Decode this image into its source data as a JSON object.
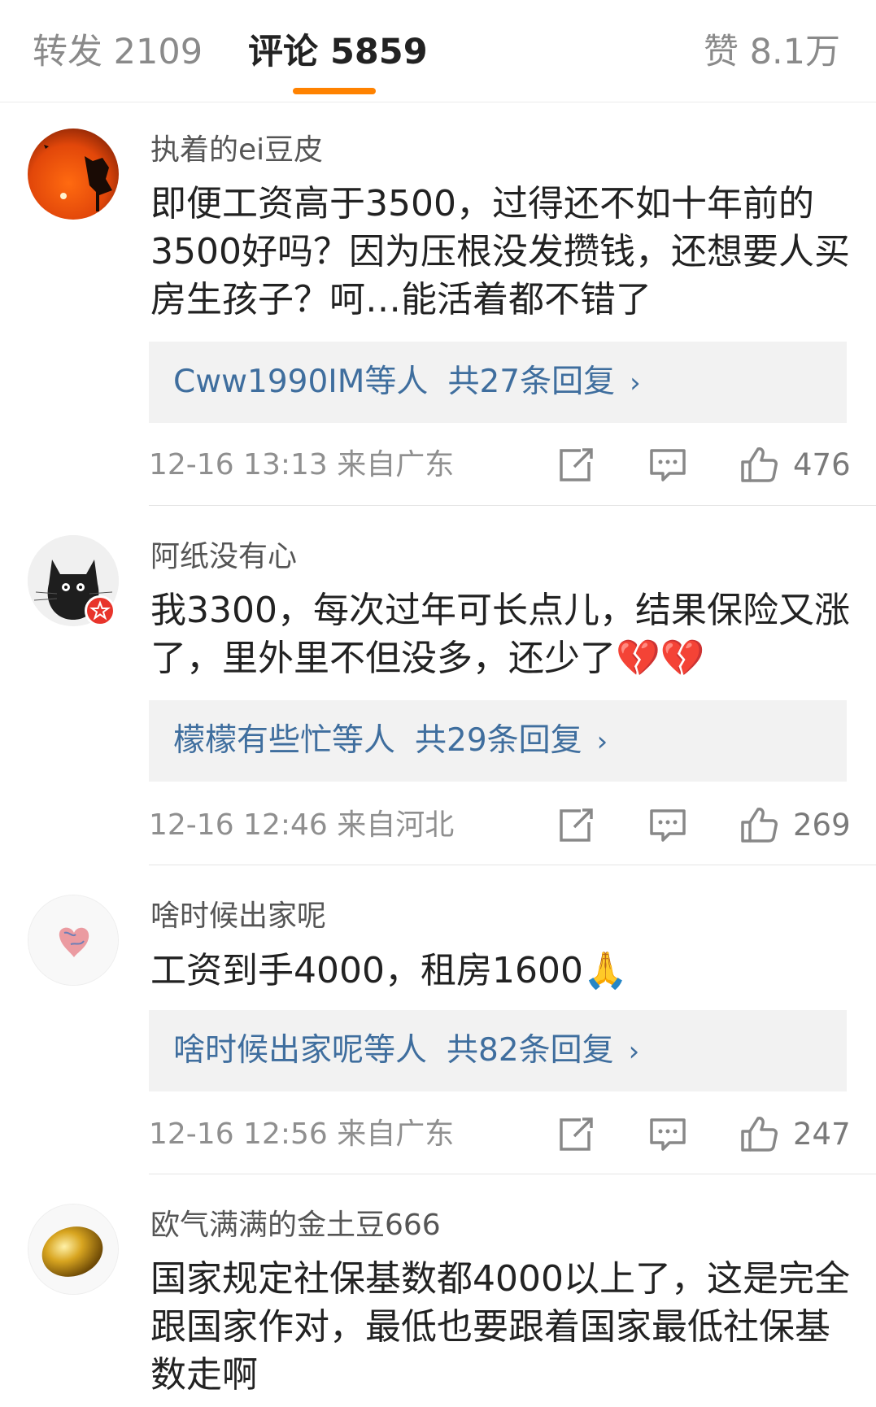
{
  "tabs": {
    "repost": "转发 2109",
    "comments": "评论 5859",
    "likes": "赞 8.1万"
  },
  "colors": {
    "accent": "#ff8200",
    "link": "#3f6e9e",
    "reply_bg": "#f2f2f2"
  },
  "comments": [
    {
      "username": "执着的ei豆皮",
      "text": "即便工资高于3500，过得还不如十年前的3500好吗？因为压根没发攒钱，还想要人买房生孩子？呵…能活着都不错了",
      "reply_users": "Cww1990IM等人",
      "reply_count": "共27条回复",
      "meta": "12-16 13:13  来自广东",
      "likes": "476",
      "avatar_icon": "sunset-avatar"
    },
    {
      "username": "阿纸没有心",
      "text": "我3300，每次过年可长点儿，结果保险又涨了，里外里不但没多，还少了💔💔",
      "reply_users": "檬檬有些忙等人",
      "reply_count": "共29条回复",
      "meta": "12-16 12:46  来自河北",
      "likes": "269",
      "avatar_icon": "black-cat-avatar"
    },
    {
      "username": "啥时候出家呢",
      "text": "工资到手4000，租房1600🙏",
      "reply_users": "啥时候出家呢等人",
      "reply_count": "共82条回复",
      "meta": "12-16 12:56  来自广东",
      "likes": "247",
      "avatar_icon": "heart-sketch-avatar"
    },
    {
      "username": "欧气满满的金土豆666",
      "text": "国家规定社保基数都4000以上了，这是完全跟国家作对，最低也要跟着国家最低社保基数走啊",
      "avatar_icon": "golden-potato-avatar"
    }
  ]
}
